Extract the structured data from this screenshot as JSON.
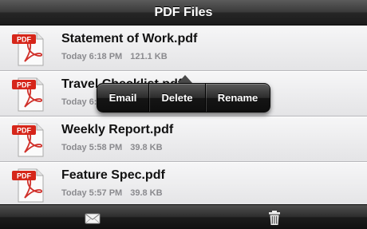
{
  "navbar": {
    "title": "PDF Files"
  },
  "files": [
    {
      "name": "Statement of Work.pdf",
      "time": "Today 6:18 PM",
      "size": "121.1 KB"
    },
    {
      "name": "Travel Checklist.pdf",
      "time": "Today 6:",
      "size": ""
    },
    {
      "name": "Weekly Report.pdf",
      "time": "Today 5:58 PM",
      "size": "39.8 KB"
    },
    {
      "name": "Feature Spec.pdf",
      "time": "Today 5:57 PM",
      "size": "39.8 KB"
    }
  ],
  "icon": {
    "label": "PDF",
    "badge_color": "#d6261a"
  },
  "popover": {
    "email": "Email",
    "delete": "Delete",
    "rename": "Rename"
  },
  "toolbar": {
    "left_icon": "mail-icon",
    "right_icon": "trash-icon"
  }
}
